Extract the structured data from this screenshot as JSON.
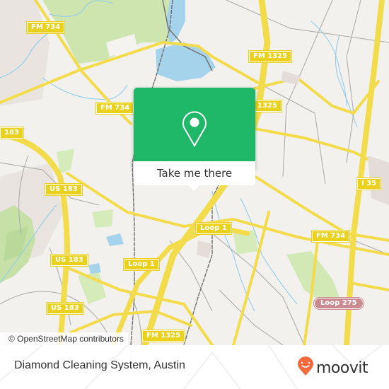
{
  "map": {
    "colors": {
      "background": "#f2f1ed",
      "park": "#cfe5b0",
      "water": "#a6d3ec",
      "road_major": "#f3dc4c",
      "road_minor": "#9a9a9a",
      "urban": "#e6e0dc",
      "popup_green": "#1fb868"
    },
    "road_labels": [
      {
        "id": "fm734-nw",
        "text": "FM 734"
      },
      {
        "id": "fm734-mid",
        "text": "FM 734"
      },
      {
        "id": "fm734-e",
        "text": "FM 734"
      },
      {
        "id": "us183-w",
        "text": "183"
      },
      {
        "id": "us183-1",
        "text": "US 183"
      },
      {
        "id": "us183-2",
        "text": "US 183"
      },
      {
        "id": "us183-3",
        "text": "US 183"
      },
      {
        "id": "fm1325-n",
        "text": "FM 1325"
      },
      {
        "id": "fm1325-mid",
        "text": "1325"
      },
      {
        "id": "fm1325-s",
        "text": "FM 1325"
      },
      {
        "id": "i35",
        "text": "I 35"
      },
      {
        "id": "loop1-a",
        "text": "Loop 1"
      },
      {
        "id": "loop1-b",
        "text": "Loop 1"
      },
      {
        "id": "loop275",
        "text": "Loop 275"
      }
    ],
    "attribution": "© OpenStreetMap contributors"
  },
  "popup": {
    "button_label": "Take me there",
    "icon": "location-pin-icon"
  },
  "footer": {
    "place_name": "Diamond Cleaning System, Austin",
    "brand": "moovit",
    "brand_color": "#f26a3d"
  }
}
